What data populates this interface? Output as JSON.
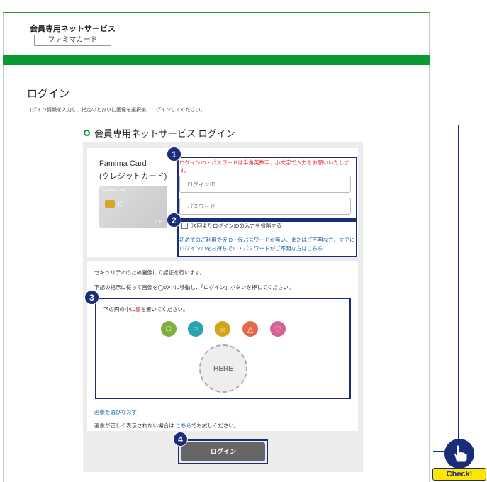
{
  "header": {
    "service_title": "会員専用ネットサービス",
    "service_subtitle": "ファミマカード"
  },
  "page": {
    "title": "ログイン",
    "description": "ログイン情報を入力し、指定のとおりに画像を選択後、ログインしてください。"
  },
  "section": {
    "title": "会員専用ネットサービス ログイン"
  },
  "card": {
    "name_line1": "Famima Card",
    "name_line2": "(クレジットカード)",
    "image_caption": "Famima Card"
  },
  "form": {
    "note": "ログインID・パスワードは半角英数字、小文字で入力をお願いいたします。",
    "login_id_placeholder": "ログインID",
    "password_placeholder": "パスワード",
    "remember_label": "次回よりログインIDの入力を省略する",
    "help_link": "初めてのご利用で仮ID・仮パスワードが無い、またはご不明な方、すでにログインIDをお持ちでID・パスワードがご不明な方はこちら"
  },
  "security": {
    "line1": "セキュリティのため画像にて認証を行います。",
    "line2": "下記の指示に従って画像を◯の中に移動し、「ログイン」ボタンを押してください。",
    "instruction_prefix": "下の円の中に",
    "instruction_highlight": "星",
    "instruction_suffix": "を置いてください。",
    "shapes": [
      {
        "icon": "square",
        "glyph": "□",
        "color": "#7fae3a"
      },
      {
        "icon": "circle",
        "glyph": "○",
        "color": "#2aa3b0"
      },
      {
        "icon": "star",
        "glyph": "☆",
        "color": "#d1a517"
      },
      {
        "icon": "triangle",
        "glyph": "△",
        "color": "#e06a4b"
      },
      {
        "icon": "heart",
        "glyph": "♡",
        "color": "#d46197"
      }
    ],
    "drop_zone_label": "HERE",
    "reselect_link": "画像を選びなおす",
    "fallback_prefix": "画像が正しく表示されない場合は ",
    "fallback_link": "こちら",
    "fallback_suffix": "でお試しください。"
  },
  "login_button": "ログイン",
  "annotations": {
    "badges": [
      "1",
      "2",
      "3",
      "4"
    ],
    "check_label": "Check!"
  },
  "colors": {
    "brand_green": "#0a9a34",
    "annotation_navy": "#1b2d7a",
    "check_yellow": "#ffe600",
    "link_blue": "#1a62b8",
    "note_red": "#e03030"
  }
}
